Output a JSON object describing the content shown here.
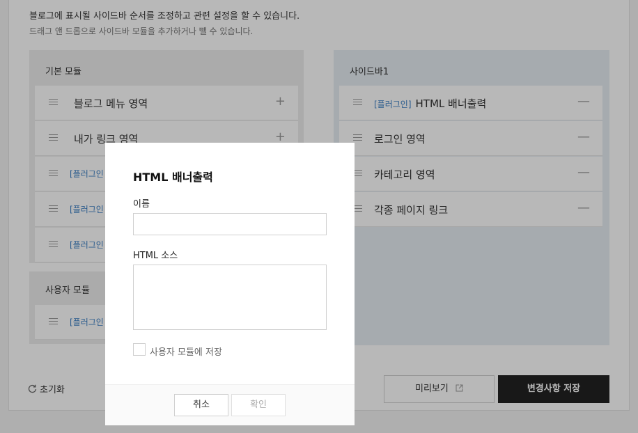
{
  "description": {
    "line1": "블로그에 표시될 사이드바 순서를 조정하고 관련 설정을 할 수 있습니다.",
    "line2": "드래그 앤 드롭으로 사이드바 모듈을 추가하거나 뺄 수 있습니다."
  },
  "basic_modules": {
    "title": "기본 모듈",
    "items": [
      {
        "tag": "",
        "label": "블로그 메뉴 영역",
        "action": "+"
      },
      {
        "tag": "",
        "label": "내가 링크 영역",
        "action": "+"
      },
      {
        "tag": "[플러그인",
        "label": "",
        "action": ""
      },
      {
        "tag": "[플러그인",
        "label": "",
        "action": ""
      },
      {
        "tag": "[플러그인",
        "label": "",
        "action": ""
      }
    ]
  },
  "user_modules": {
    "title": "사용자 모듈",
    "items": [
      {
        "tag": "[플러그인",
        "label": "",
        "action": ""
      }
    ]
  },
  "sidebar1": {
    "title": "사이드바1",
    "items": [
      {
        "tag": "[플러그인]",
        "label": "HTML 배너출력",
        "action": "—"
      },
      {
        "tag": "",
        "label": "로그인 영역",
        "action": "—"
      },
      {
        "tag": "",
        "label": "카테고리 영역",
        "action": "—"
      },
      {
        "tag": "",
        "label": "각종 페이지 링크",
        "action": "—"
      }
    ]
  },
  "footer": {
    "reset_label": "초기화",
    "preview_label": "미리보기",
    "save_label": "변경사항 저장"
  },
  "modal": {
    "title": "HTML 배너출력",
    "name_label": "이름",
    "name_value": "",
    "source_label": "HTML 소스",
    "source_value": "",
    "checkbox_label": "사용자 모듈에 저장",
    "checkbox_checked": false,
    "cancel_label": "취소",
    "confirm_label": "확인"
  },
  "colors": {
    "accent_tag": "#3b7fc4",
    "save_button": "#222222",
    "sidebar_bg": "#e6edf3"
  }
}
